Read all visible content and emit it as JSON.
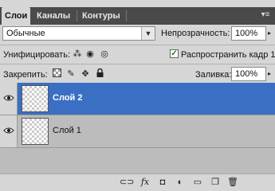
{
  "tabs": [
    {
      "label": "Слои",
      "active": true
    },
    {
      "label": "Каналы",
      "active": false
    },
    {
      "label": "Контуры",
      "active": false
    }
  ],
  "blend_mode": {
    "value": "Обычные"
  },
  "opacity": {
    "label": "Непрозрачность:",
    "value": "100%"
  },
  "unify": {
    "label": "Унифицировать:"
  },
  "propagate": {
    "label": "Распространить кадр 1",
    "checked": true
  },
  "lock": {
    "label": "Закрепить:"
  },
  "fill": {
    "label": "Заливка:",
    "value": "100%"
  },
  "layers": [
    {
      "name": "Слой 2",
      "selected": true,
      "visible": true
    },
    {
      "name": "Слой 1",
      "selected": false,
      "visible": true
    }
  ],
  "colors": {
    "selection": "#3a6fc3",
    "tabbar": "#4a4a4a",
    "panel": "#d6d6d6"
  }
}
